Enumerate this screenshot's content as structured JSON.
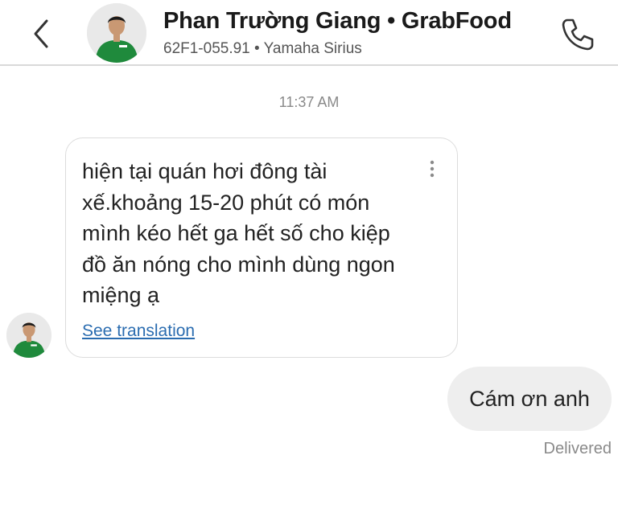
{
  "header": {
    "title": "Phan Trường Giang • GrabFood",
    "subtitle": "62F1-055.91 • Yamaha Sirius",
    "back_icon": "chevron-left-icon",
    "call_icon": "phone-icon"
  },
  "conversation": {
    "timestamp": "11:37 AM",
    "incoming": {
      "text": "hiện tại quán hơi đông tài xế.khoảng 15-20 phút có món mình kéo hết ga hết số cho kiệp đồ ăn nóng cho mình dùng ngon miệng ạ",
      "see_translation": "See translation",
      "menu_icon": "more-vertical-icon"
    },
    "outgoing": {
      "text": "Cám ơn anh",
      "status": "Delivered"
    }
  },
  "colors": {
    "brand_green": "#1f8a3c",
    "link_blue": "#2a6cb0",
    "outgoing_bubble": "#eeeeee"
  }
}
